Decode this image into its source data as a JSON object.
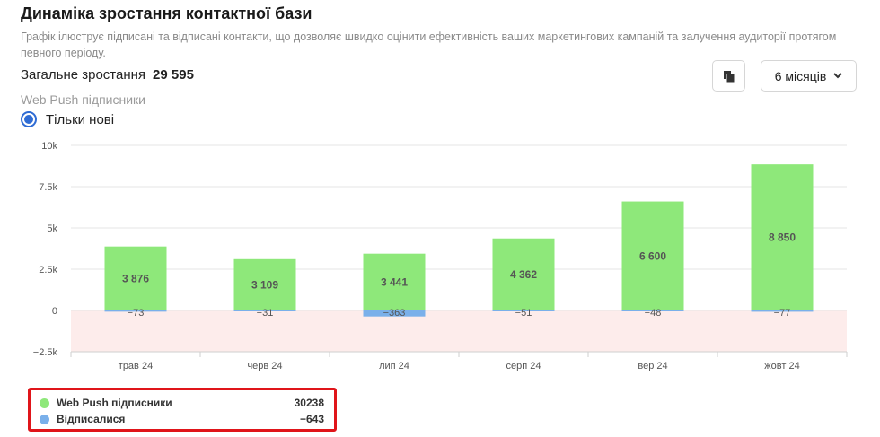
{
  "header": {
    "title": "Динаміка зростання контактної бази",
    "description": "Графік ілюструє підписані та відписані контакти, що дозволяє швидко оцінити ефективність ваших маркетингових кампаній та залучення аудиторії протягом певного періоду.",
    "total_label": "Загальне зростання",
    "total_value": "29 595",
    "series_label": "Web Push підписники"
  },
  "filter": {
    "radio_label": "Тільки нові",
    "radio_selected": true
  },
  "toolbar": {
    "copy_icon": "copy-icon",
    "period_label": "6 місяців",
    "period_icon": "chevron-down-icon"
  },
  "colors": {
    "subscribed": "#8ee87a",
    "unsubscribed": "#7ab0ea",
    "negative_zone": "#fdeceb",
    "accent": "#2f6cd4"
  },
  "chart_data": {
    "type": "bar",
    "categories": [
      "трав 24",
      "черв 24",
      "лип 24",
      "серп 24",
      "вер 24",
      "жовт 24"
    ],
    "series": [
      {
        "name": "Web Push підписники",
        "values": [
          3876,
          3109,
          3441,
          4362,
          6600,
          8850
        ],
        "labels": [
          "3 876",
          "3 109",
          "3 441",
          "4 362",
          "6 600",
          "8 850"
        ]
      },
      {
        "name": "Відписалися",
        "values": [
          -73,
          -31,
          -363,
          -51,
          -48,
          -77
        ],
        "labels": [
          "−73",
          "−31",
          "−363",
          "−51",
          "−48",
          "−77"
        ]
      }
    ],
    "ylim": [
      -2500,
      10000
    ],
    "yticks": [
      10000,
      7500,
      5000,
      2500,
      0,
      -2500
    ],
    "ytick_labels": [
      "10k",
      "7.5k",
      "5k",
      "2.5k",
      "0",
      "−2.5k"
    ],
    "grid": true,
    "legend": [
      {
        "name": "Web Push підписники",
        "total": "30238"
      },
      {
        "name": "Відписалися",
        "total": "−643"
      }
    ],
    "legend_position": "bottom-left"
  }
}
